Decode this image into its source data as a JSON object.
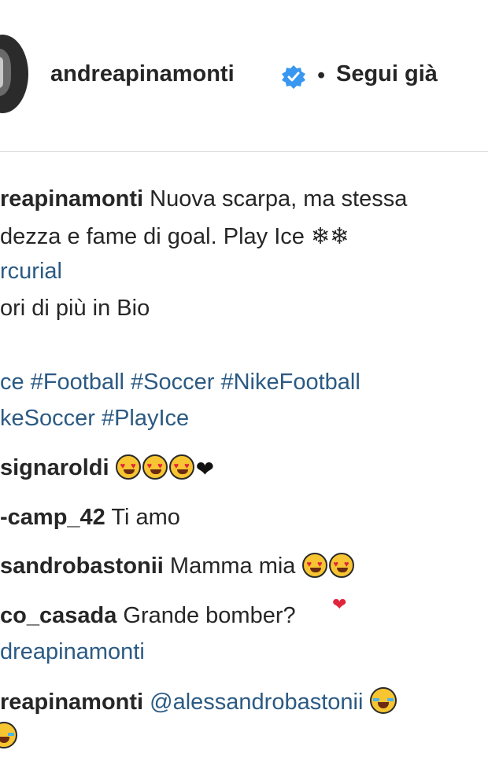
{
  "post_header": {
    "username": "andreapinamonti",
    "verified_icon": "verified-badge-icon",
    "separator": "•",
    "follow_status": "Segui già"
  },
  "caption": {
    "author": "reapinamonti",
    "line1_text": "Nuova scarpa, ma stessa",
    "line2_text": "dezza e fame di goal. Play Ice ❄❄",
    "line3_tag": "rcurial",
    "line4_text": "ori di più in Bio",
    "line5_tags": "ce #Football #Soccer #NikeFootball",
    "line6_tags": "keSoccer #PlayIce"
  },
  "comments": [
    {
      "user": "signaroldi",
      "text": "",
      "emoji": [
        "heart-eyes-emoji",
        "heart-eyes-emoji",
        "heart-eyes-emoji",
        "black-heart-icon"
      ],
      "black_heart": "❤"
    },
    {
      "user": "-camp_42",
      "text": "Ti amo"
    },
    {
      "user": "sandrobastonii",
      "text": "Mamma mia",
      "emoji": [
        "heart-eyes-emoji",
        "heart-eyes-emoji"
      ]
    },
    {
      "user": "co_casada",
      "text": "Grande bomber",
      "suffix": "?",
      "mention": "dreapinamonti",
      "red_heart": "❤"
    },
    {
      "user": "reapinamonti",
      "mention": "@alessandrobastonii",
      "emoji": [
        "laughing-tears-emoji",
        "laughing-tears-emoji"
      ]
    }
  ],
  "colors": {
    "link": "#2b5a83",
    "text": "#262626",
    "verified": "#3897f0",
    "divider": "#dbdbdb"
  }
}
